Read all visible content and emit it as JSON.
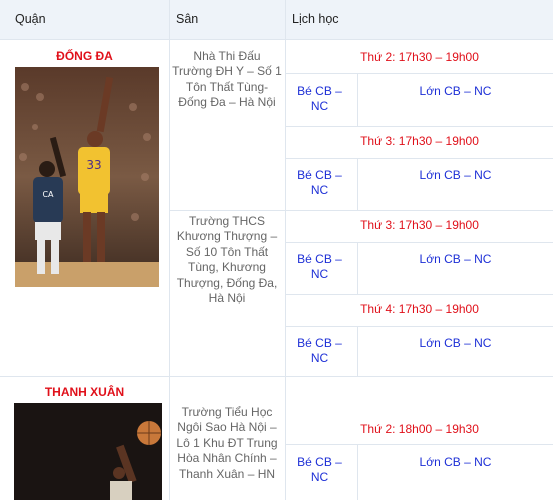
{
  "headers": {
    "district": "Quận",
    "venue": "Sân",
    "schedule": "Lịch học"
  },
  "rows": [
    {
      "district": "ĐỐNG ĐA",
      "venues": [
        {
          "name": "Nhà Thi Đấu Trường ĐH Y – Số 1 Tôn Thất Tùng-Đống Đa – Hà Nội",
          "slots": [
            {
              "day": "Thứ 2: 17h30 – 19h00",
              "kids": "Bé CB – NC",
              "adults": "Lớn CB – NC"
            },
            {
              "day": "Thứ 3: 17h30 – 19h00",
              "kids": "Bé CB – NC",
              "adults": "Lớn CB – NC"
            }
          ]
        },
        {
          "name": "Trường THCS Khương Thượng – Số 10 Tôn Thất Tùng, Khương Thượng, Đống Đa, Hà Nội",
          "slots": [
            {
              "day": "Thứ 3:  17h30 – 19h00",
              "kids": "Bé CB – NC",
              "adults": "Lớn CB – NC"
            },
            {
              "day": "Thứ 4:  17h30 – 19h00",
              "kids": "Bé CB – NC",
              "adults": "Lớn CB – NC"
            }
          ]
        }
      ]
    },
    {
      "district": "THANH XUÂN",
      "venues": [
        {
          "name": "Trường Tiểu Học Ngôi Sao Hà Nội – Lô 1 Khu ĐT Trung Hòa Nhân Chính – Thanh Xuân – HN",
          "slots": [
            {
              "day": "Thứ 2:  18h00 – 19h30",
              "kids": "Bé CB – NC",
              "adults": "Lớn CB – NC"
            }
          ]
        }
      ]
    }
  ],
  "colors": {
    "red": "#e0101a",
    "blue": "#1d2fd6",
    "header_bg": "#eef3f9",
    "border": "#dfe6ee"
  },
  "images": [
    "basketball-photo-icon",
    "basketball-photo-icon"
  ]
}
